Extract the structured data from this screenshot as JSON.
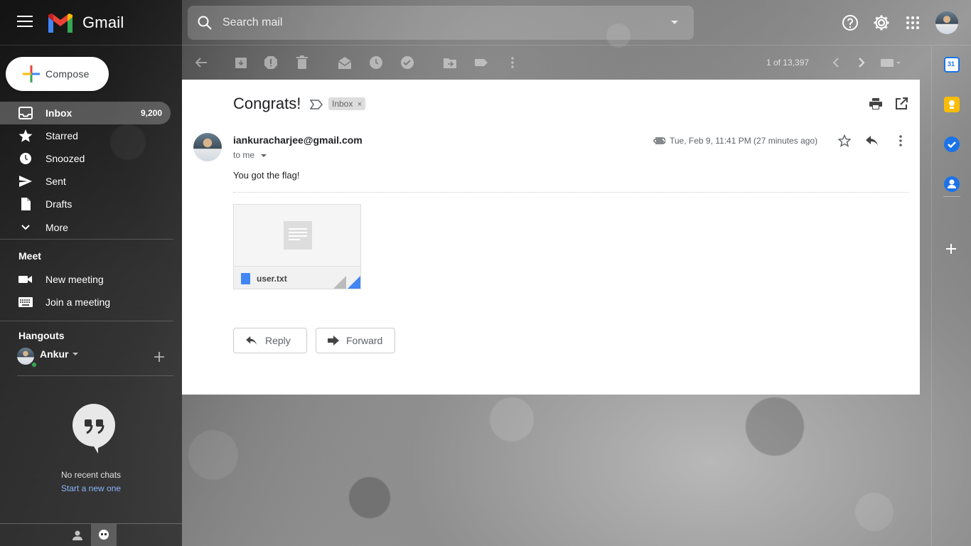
{
  "app": {
    "name": "Gmail"
  },
  "search": {
    "placeholder": "Search mail"
  },
  "compose": {
    "label": "Compose"
  },
  "nav": {
    "items": [
      {
        "label": "Inbox",
        "count": "9,200"
      },
      {
        "label": "Starred"
      },
      {
        "label": "Snoozed"
      },
      {
        "label": "Sent"
      },
      {
        "label": "Drafts"
      },
      {
        "label": "More"
      }
    ]
  },
  "meet": {
    "title": "Meet",
    "items": [
      {
        "label": "New meeting"
      },
      {
        "label": "Join a meeting"
      }
    ]
  },
  "hangouts": {
    "title": "Hangouts",
    "user": "Ankur",
    "no_chats": "No recent chats",
    "start_new": "Start a new one"
  },
  "toolbar": {
    "count": "1 of 13,397"
  },
  "email": {
    "subject": "Congrats!",
    "label": "Inbox",
    "sender": "iankuracharjee@gmail.com",
    "to": "to me",
    "date": "Tue, Feb 9, 11:41 PM (27 minutes ago)",
    "body": "You got the flag!",
    "attachment": {
      "name": "user.txt"
    },
    "reply_label": "Reply",
    "forward_label": "Forward"
  },
  "colors": {
    "accent_blue": "#4285f4",
    "calendar_blue": "#1a73e8",
    "keep_yellow": "#fbbc04"
  }
}
